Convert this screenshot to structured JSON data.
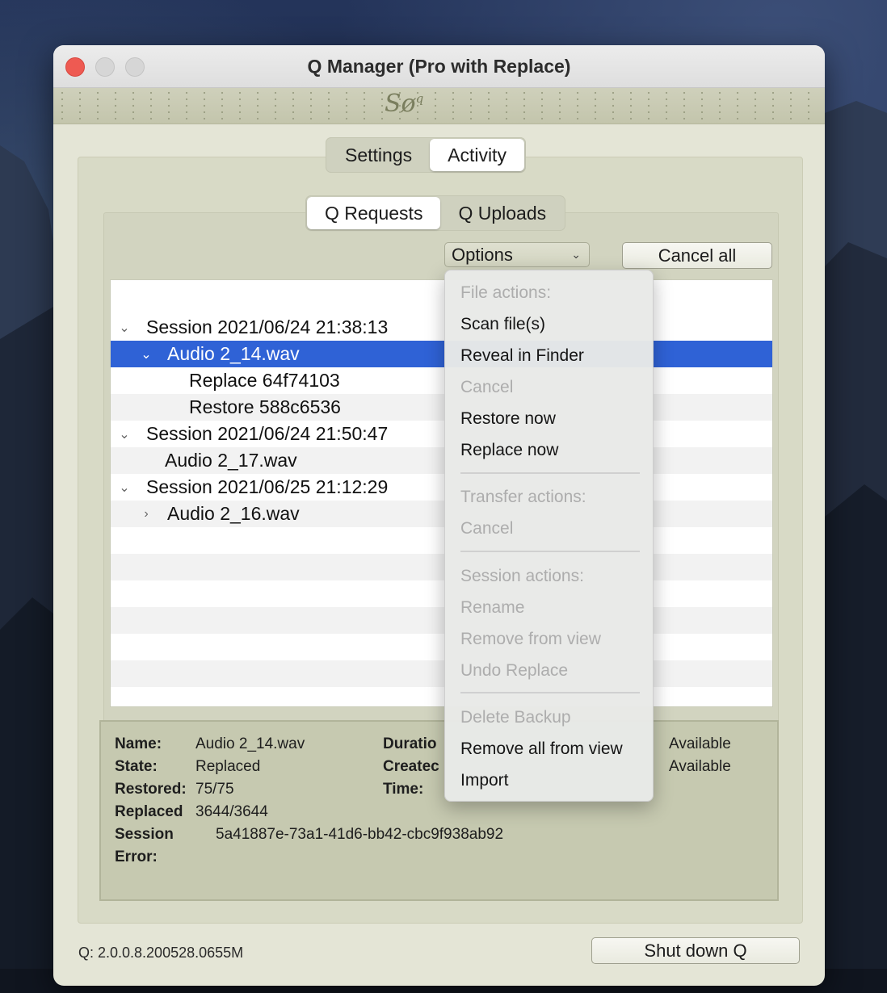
{
  "window": {
    "title": "Q Manager (Pro with Replace)"
  },
  "banner": {
    "logo": "Sø",
    "logo_sup": "q"
  },
  "main_tabs": [
    {
      "label": "Settings",
      "selected": false
    },
    {
      "label": "Activity",
      "selected": true
    }
  ],
  "sub_tabs": [
    {
      "label": "Q Requests",
      "selected": true
    },
    {
      "label": "Q Uploads",
      "selected": false
    }
  ],
  "toolbar": {
    "options_label": "Options",
    "cancel_all_label": "Cancel all"
  },
  "tree": {
    "rows": [
      {
        "label": "Session 2021/06/24 21:38:13",
        "level": 0,
        "disclosure": "open"
      },
      {
        "label": "Audio 2_14.wav",
        "level": 1,
        "disclosure": "open",
        "selected": true
      },
      {
        "label": "Replace 64f74103",
        "level": 2,
        "disclosure": "none"
      },
      {
        "label": "Restore 588c6536",
        "level": 2,
        "disclosure": "none"
      },
      {
        "label": "Session 2021/06/24 21:50:47",
        "level": 0,
        "disclosure": "open"
      },
      {
        "label": "Audio 2_17.wav",
        "level": 1,
        "disclosure": "none"
      },
      {
        "label": "Session 2021/06/25 21:12:29",
        "level": 0,
        "disclosure": "open"
      },
      {
        "label": "Audio 2_16.wav",
        "level": 1,
        "disclosure": "closed"
      }
    ]
  },
  "details": {
    "name_label": "Name:",
    "name_value": "Audio 2_14.wav",
    "state_label": "State:",
    "state_value": "Replaced",
    "restored_label": "Restored:",
    "restored_value": "75/75",
    "replaced_label": "Replaced",
    "replaced_value": "3644/3644",
    "session_label": "Session",
    "session_value": "5a41887e-73a1-41d6-bb42-cbc9f938ab92",
    "error_label": "Error:",
    "duration_label": "Duratio",
    "created_label": "Createc",
    "time_label": "Time:",
    "avail1": "Available",
    "avail2": "Available"
  },
  "footer": {
    "version": "Q: 2.0.0.8.200528.0655M",
    "shutdown_label": "Shut down Q"
  },
  "menu": {
    "items": [
      {
        "label": "File actions:",
        "enabled": false,
        "kind": "header"
      },
      {
        "label": "Scan file(s)",
        "enabled": true
      },
      {
        "label": "Reveal in Finder",
        "enabled": true
      },
      {
        "label": "Cancel",
        "enabled": false
      },
      {
        "label": "Restore now",
        "enabled": true
      },
      {
        "label": "Replace now",
        "enabled": true
      },
      {
        "label": "Transfer actions:",
        "enabled": false,
        "kind": "header"
      },
      {
        "label": "Cancel",
        "enabled": false
      },
      {
        "label": "Session actions:",
        "enabled": false,
        "kind": "header"
      },
      {
        "label": "Rename",
        "enabled": false
      },
      {
        "label": "Remove from view",
        "enabled": false
      },
      {
        "label": "Undo Replace",
        "enabled": false
      },
      {
        "label": "Delete Backup",
        "enabled": false
      },
      {
        "label": "Remove all from view",
        "enabled": true
      },
      {
        "label": "Import",
        "enabled": true
      }
    ]
  },
  "colors": {
    "selection": "#2f62d6",
    "close_button": "#ee5a52",
    "panel": "#e4e5d6"
  }
}
